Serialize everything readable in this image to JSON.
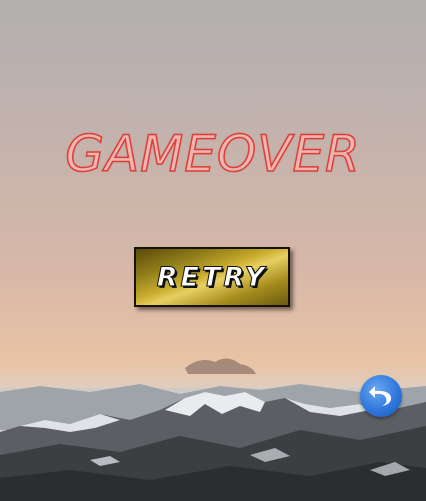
{
  "screen": {
    "title": "GAMEOVER",
    "retry_label": "RETRY",
    "back_icon": "undo-arrow-icon"
  },
  "colors": {
    "title_fill": "#f0b5ae",
    "title_stroke": "#d9403a",
    "button_gold": "#c9ac2e",
    "back_button_blue": "#2f78dc"
  }
}
